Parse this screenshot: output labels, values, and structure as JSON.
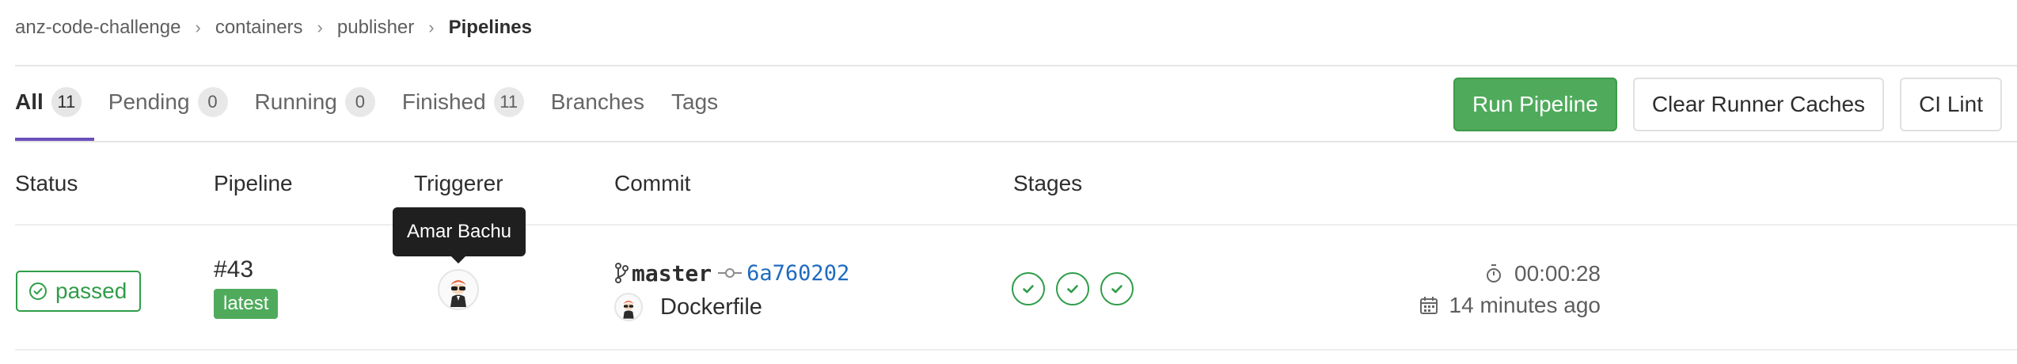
{
  "breadcrumb": {
    "items": [
      "anz-code-challenge",
      "containers",
      "publisher"
    ],
    "current": "Pipelines",
    "separator": "›"
  },
  "tabs": [
    {
      "label": "All",
      "count": "11",
      "active": true
    },
    {
      "label": "Pending",
      "count": "0"
    },
    {
      "label": "Running",
      "count": "0"
    },
    {
      "label": "Finished",
      "count": "11"
    },
    {
      "label": "Branches"
    },
    {
      "label": "Tags"
    }
  ],
  "actions": {
    "run_pipeline": "Run Pipeline",
    "clear_caches": "Clear Runner Caches",
    "ci_lint": "CI Lint"
  },
  "table": {
    "headers": [
      "Status",
      "Pipeline",
      "Triggerer",
      "Commit",
      "Stages"
    ]
  },
  "row": {
    "status": "passed",
    "pipeline_id": "#43",
    "pipeline_badge": "latest",
    "triggerer_tooltip": "Amar Bachu",
    "branch": "master",
    "sha": "6a760202",
    "commit_title": "Dockerfile",
    "stages": [
      "passed",
      "passed",
      "passed"
    ],
    "duration": "00:00:28",
    "finished": "14 minutes ago"
  },
  "colors": {
    "success": "#2f9d49",
    "primary_button": "#4fab5b",
    "active_tab_underline": "#6b4fbb",
    "link": "#1f6bbf"
  },
  "icons": [
    "chevron-right-icon",
    "check-circle-icon",
    "branch-icon",
    "commit-icon",
    "check-icon",
    "timer-icon",
    "calendar-icon"
  ]
}
